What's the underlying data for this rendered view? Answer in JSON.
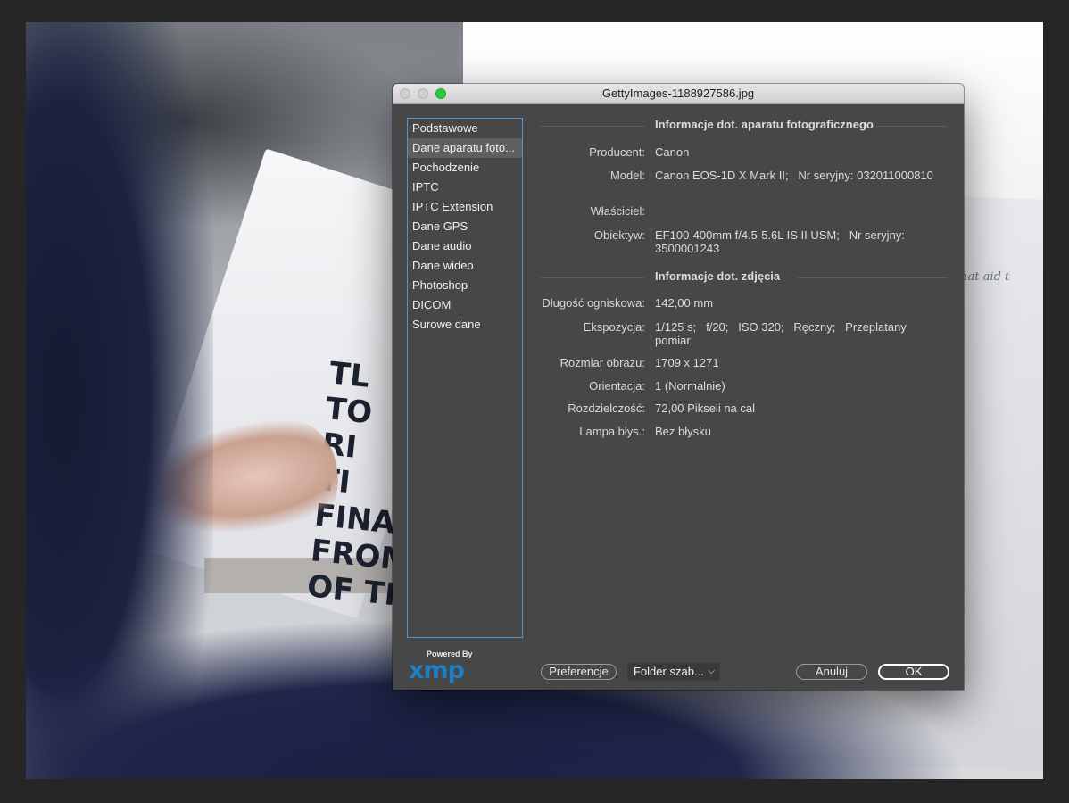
{
  "window": {
    "title": "GettyImages-1188927586.jpg"
  },
  "background": {
    "paper_text": "o that aid t",
    "scribble": "TL\nTO\nRI\nTI\nFINA\nFROM\nOF TH"
  },
  "sidebar": {
    "items": [
      {
        "label": "Podstawowe",
        "active": false
      },
      {
        "label": "Dane aparatu foto...",
        "active": true
      },
      {
        "label": "Pochodzenie",
        "active": false
      },
      {
        "label": "IPTC",
        "active": false
      },
      {
        "label": "IPTC Extension",
        "active": false
      },
      {
        "label": "Dane GPS",
        "active": false
      },
      {
        "label": "Dane audio",
        "active": false
      },
      {
        "label": "Dane wideo",
        "active": false
      },
      {
        "label": "Photoshop",
        "active": false
      },
      {
        "label": "DICOM",
        "active": false
      },
      {
        "label": "Surowe dane",
        "active": false
      }
    ]
  },
  "camera_section": {
    "title": "Informacje dot. aparatu fotograficznego",
    "rows": [
      {
        "label": "Producent:",
        "value": "Canon"
      },
      {
        "label": "Model:",
        "value": "Canon EOS-1D X Mark II;   Nr seryjny: 032011000810"
      },
      {
        "label": "Właściciel:",
        "value": ""
      },
      {
        "label": "Obiektyw:",
        "value": "EF100-400mm f/4.5-5.6L IS II USM;   Nr seryjny: 3500001243"
      }
    ]
  },
  "photo_section": {
    "title": "Informacje dot. zdjęcia",
    "rows": [
      {
        "label": "Długość ogniskowa:",
        "value": "142,00 mm"
      },
      {
        "label": "Ekspozycja:",
        "value": "1/125 s;   f/20;   ISO 320;   Ręczny;   Przeplatany pomiar"
      },
      {
        "label": "Rozmiar obrazu:",
        "value": "1709 x 1271"
      },
      {
        "label": "Orientacja:",
        "value": "1 (Normalnie)"
      },
      {
        "label": "Rozdzielczość:",
        "value": "72,00 Pikseli na cal"
      },
      {
        "label": "Lampa błys.:",
        "value": "Bez błysku"
      }
    ]
  },
  "branding": {
    "powered_by": "Powered By",
    "logo": "xmp",
    "logo_color": "#1f7fc5"
  },
  "footer": {
    "preferences_label": "Preferencje",
    "template_folder_label": "Folder szab...",
    "cancel_label": "Anuluj",
    "ok_label": "OK"
  },
  "icons": {
    "dropdown": "chevron-down-icon"
  },
  "colors": {
    "accent": "#4f93d8",
    "maximize": "#2ac840"
  }
}
